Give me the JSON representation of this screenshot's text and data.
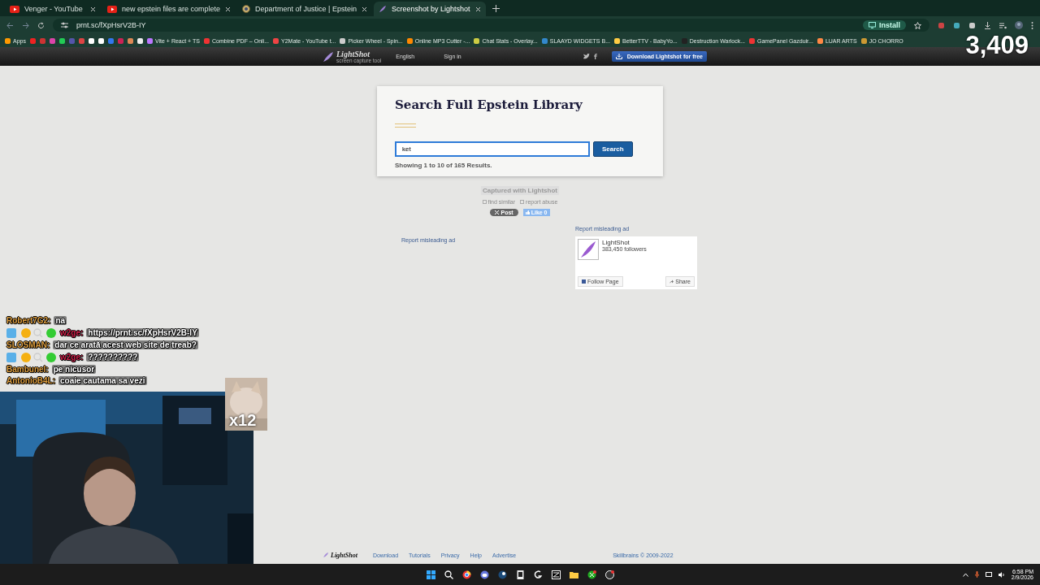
{
  "browser": {
    "tabs": [
      {
        "title": "Venger - YouTube",
        "selected": false
      },
      {
        "title": "new epstein files are complete",
        "selected": false
      },
      {
        "title": "Department of Justice | Epstein",
        "selected": false
      },
      {
        "title": "Screenshot by Lightshot",
        "selected": true
      }
    ],
    "url": "prnt.sc/fXpHsrV2B-IY",
    "install_button": "Install",
    "bookmarks": [
      "Apps",
      "Vite + React + TS",
      "Combine PDF – Onli...",
      "Y2Mate - YouTube t...",
      "Picker Wheel - Spin...",
      "Online MP3 Cutter -...",
      "Chat Stats - Overlay...",
      "SLAAYD WIDGETS B...",
      "BetterTTV - BabyYo...",
      "Destruction Warlock...",
      "GamePanel Gazduir...",
      "LUAR ARTS",
      "JO CHORRO"
    ]
  },
  "viewer_count": "3,409",
  "site_header": {
    "logo": "LightShot",
    "tagline": "screen capture tool",
    "language": "English",
    "sign_in": "Sign in",
    "download_button": "Download Lightshot for free"
  },
  "search_card": {
    "title": "Search Full Epstein Library",
    "query": "ket",
    "button": "Search",
    "results": "Showing 1 to 10 of 165 Results."
  },
  "capture_info": {
    "caption": "Captured with Lightshot",
    "links": [
      "find similar",
      "report abuse"
    ],
    "post_button": "Post",
    "like_button": "Like 0"
  },
  "ad_reports": [
    "Report misleading ad",
    "Report misleading ad"
  ],
  "facebook_widget": {
    "name": "LightShot",
    "followers": "383,450 followers",
    "follow_button": "Follow Page",
    "share_button": "Share"
  },
  "chat": [
    {
      "author": "Robert7G2:",
      "message": "na",
      "color": "#e0a040",
      "badges": false
    },
    {
      "author": "w2ge:",
      "message": "https://prnt.sc/fXpHsrV2B-IY",
      "color": "#d0204a",
      "badges": true
    },
    {
      "author": "SLOSMAN:",
      "message": "dar ce arată acest web site de treab?",
      "color": "#e0a040",
      "badges": false
    },
    {
      "author": "w2ge:",
      "message": "??????????",
      "color": "#d0204a",
      "badges": true
    },
    {
      "author": "Bambunel:",
      "message": "pe nicusor",
      "color": "#e0a040",
      "badges": false
    },
    {
      "author": "AntonioB4L:",
      "message": "coaie cautama sa vezi",
      "color": "#e0a040",
      "badges": false
    }
  ],
  "emote_count": "x12",
  "footer": {
    "logo": "LightShot",
    "links": [
      "Download",
      "Tutorials",
      "Privacy",
      "Help",
      "Advertise"
    ],
    "copyright": "Skillbrains © 2009-2022"
  },
  "taskbar": {
    "time": "6:58 PM",
    "date": "2/9/2026"
  }
}
